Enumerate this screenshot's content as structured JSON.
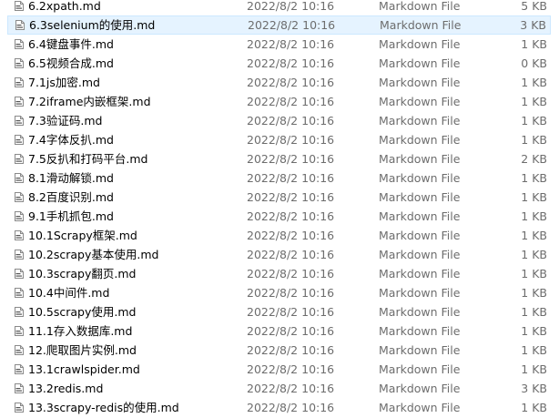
{
  "files": [
    {
      "name": "6.2xpath.md",
      "date": "2022/8/2 10:16",
      "type": "Markdown File",
      "size": "5 KB",
      "selected": false
    },
    {
      "name": "6.3selenium的使用.md",
      "date": "2022/8/2 10:16",
      "type": "Markdown File",
      "size": "3 KB",
      "selected": true
    },
    {
      "name": "6.4键盘事件.md",
      "date": "2022/8/2 10:16",
      "type": "Markdown File",
      "size": "1 KB",
      "selected": false
    },
    {
      "name": "6.5视频合成.md",
      "date": "2022/8/2 10:16",
      "type": "Markdown File",
      "size": "0 KB",
      "selected": false
    },
    {
      "name": "7.1js加密.md",
      "date": "2022/8/2 10:16",
      "type": "Markdown File",
      "size": "1 KB",
      "selected": false
    },
    {
      "name": "7.2iframe内嵌框架.md",
      "date": "2022/8/2 10:16",
      "type": "Markdown File",
      "size": "1 KB",
      "selected": false
    },
    {
      "name": "7.3验证码.md",
      "date": "2022/8/2 10:16",
      "type": "Markdown File",
      "size": "1 KB",
      "selected": false
    },
    {
      "name": "7.4字体反扒.md",
      "date": "2022/8/2 10:16",
      "type": "Markdown File",
      "size": "1 KB",
      "selected": false
    },
    {
      "name": "7.5反扒和打码平台.md",
      "date": "2022/8/2 10:16",
      "type": "Markdown File",
      "size": "2 KB",
      "selected": false
    },
    {
      "name": "8.1滑动解锁.md",
      "date": "2022/8/2 10:16",
      "type": "Markdown File",
      "size": "1 KB",
      "selected": false
    },
    {
      "name": "8.2百度识别.md",
      "date": "2022/8/2 10:16",
      "type": "Markdown File",
      "size": "1 KB",
      "selected": false
    },
    {
      "name": "9.1手机抓包.md",
      "date": "2022/8/2 10:16",
      "type": "Markdown File",
      "size": "1 KB",
      "selected": false
    },
    {
      "name": "10.1Scrapy框架.md",
      "date": "2022/8/2 10:16",
      "type": "Markdown File",
      "size": "1 KB",
      "selected": false
    },
    {
      "name": "10.2scrapy基本使用.md",
      "date": "2022/8/2 10:16",
      "type": "Markdown File",
      "size": "1 KB",
      "selected": false
    },
    {
      "name": "10.3scrapy翻页.md",
      "date": "2022/8/2 10:16",
      "type": "Markdown File",
      "size": "1 KB",
      "selected": false
    },
    {
      "name": "10.4中间件.md",
      "date": "2022/8/2 10:16",
      "type": "Markdown File",
      "size": "1 KB",
      "selected": false
    },
    {
      "name": "10.5scrapy使用.md",
      "date": "2022/8/2 10:16",
      "type": "Markdown File",
      "size": "1 KB",
      "selected": false
    },
    {
      "name": "11.1存入数据库.md",
      "date": "2022/8/2 10:16",
      "type": "Markdown File",
      "size": "1 KB",
      "selected": false
    },
    {
      "name": "12.爬取图片实例.md",
      "date": "2022/8/2 10:16",
      "type": "Markdown File",
      "size": "1 KB",
      "selected": false
    },
    {
      "name": "13.1crawlspider.md",
      "date": "2022/8/2 10:16",
      "type": "Markdown File",
      "size": "1 KB",
      "selected": false
    },
    {
      "name": "13.2redis.md",
      "date": "2022/8/2 10:16",
      "type": "Markdown File",
      "size": "3 KB",
      "selected": false
    },
    {
      "name": "13.3scrapy-redis的使用.md",
      "date": "2022/8/2 10:16",
      "type": "Markdown File",
      "size": "1 KB",
      "selected": false
    }
  ],
  "colors": {
    "selection_bg": "#e5f3ff",
    "selection_border": "#cce8ff",
    "meta_text": "#6d6d6d"
  },
  "icons": {
    "file": "markdown-file-icon"
  }
}
